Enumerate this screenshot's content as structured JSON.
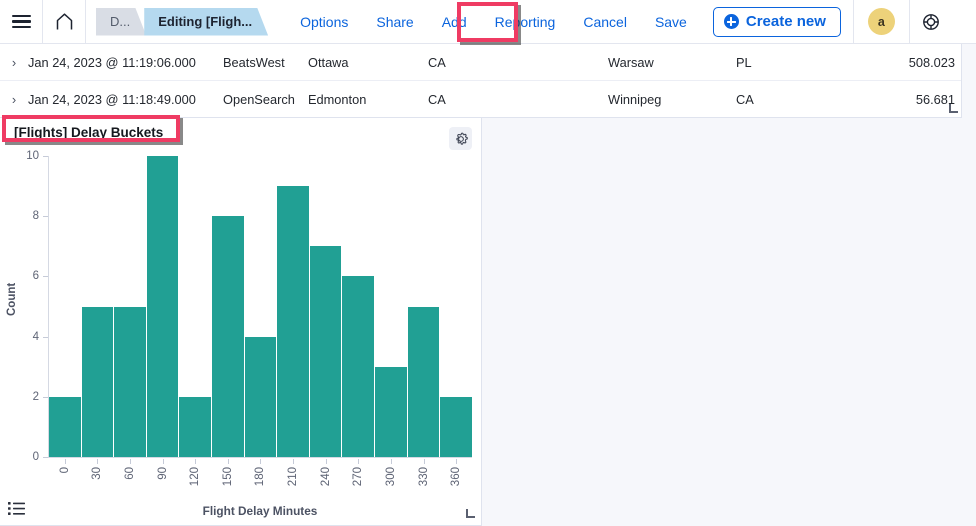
{
  "topnav": {
    "menu_icon": "hamburger-menu-icon",
    "home_icon": "home-icon",
    "crumbs": [
      {
        "label": "D...",
        "state": "inactive"
      },
      {
        "label": "Editing [Fligh...",
        "state": "active"
      }
    ],
    "links": [
      {
        "label": "Options",
        "highlighted": false
      },
      {
        "label": "Share",
        "highlighted": false
      },
      {
        "label": "Add",
        "highlighted": true
      },
      {
        "label": "Reporting",
        "highlighted": false
      },
      {
        "label": "Cancel",
        "highlighted": false
      },
      {
        "label": "Save",
        "highlighted": false
      }
    ],
    "create_new_label": "Create new",
    "create_new_icon": "plus-circle-icon",
    "avatar_initial": "a",
    "help_icon": "help-ring-icon"
  },
  "table": {
    "rows": [
      {
        "expand_icon": "chevron-right-icon",
        "timestamp": "Jan 24, 2023 @ 11:19:06.000",
        "carrier": "BeatsWest",
        "origin_city": "Ottawa",
        "origin_country": "CA",
        "dest_city": "Warsaw",
        "dest_country": "PL",
        "value": "508.023"
      },
      {
        "expand_icon": "chevron-right-icon",
        "timestamp": "Jan 24, 2023 @ 11:18:49.000",
        "carrier": "OpenSearch",
        "origin_city": "Edmonton",
        "origin_country": "CA",
        "dest_city": "Winnipeg",
        "dest_country": "CA",
        "value": "56.681"
      }
    ]
  },
  "chart_panel": {
    "title": "[Flights] Delay Buckets",
    "gear_icon": "gear-icon",
    "list_icon": "list-view-icon",
    "resize_icon": "resize-handle-icon"
  },
  "colors": {
    "bar_teal": "#21a094",
    "highlight_pink": "#ef3b63",
    "link_blue": "#0b64dd",
    "active_tab_blue": "#b5d9ef",
    "avatar_yellow": "#edd27a",
    "page_background": "#f6f7fb"
  },
  "chart_data": {
    "type": "bar",
    "title": "[Flights] Delay Buckets",
    "xlabel": "Flight Delay Minutes",
    "ylabel": "Count",
    "categories": [
      "0",
      "30",
      "60",
      "90",
      "120",
      "150",
      "180",
      "210",
      "240",
      "270",
      "300",
      "330",
      "360"
    ],
    "values": [
      2,
      5,
      5,
      10,
      2,
      8,
      4,
      9,
      7,
      6,
      3,
      5,
      2
    ],
    "ylim": [
      0,
      10
    ],
    "yticks": [
      "0",
      "2",
      "4",
      "6",
      "8",
      "10"
    ],
    "grid": false,
    "legend": false,
    "series_color": "#21a094"
  }
}
